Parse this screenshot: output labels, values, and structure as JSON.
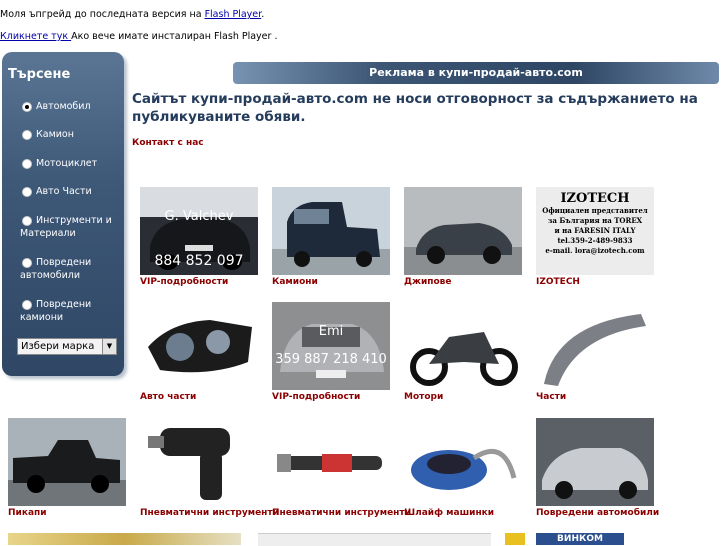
{
  "flash": {
    "line1": "Моля ъпгрейд до последната версия на ",
    "line1_link": "Flash Player",
    "line1_end": ".",
    "line2_link": "Кликнете тук ",
    "line2_rest": "Ако вече имате инсталиран Flash Player ."
  },
  "sidebar": {
    "title": "Търсене",
    "items": [
      {
        "label": "Автомобил",
        "selected": true
      },
      {
        "label": "Камион"
      },
      {
        "label": "Мотоциклет"
      },
      {
        "label": "Авто Части"
      },
      {
        "label": "Инструменти и Материали"
      },
      {
        "label": "Повредени автомобили"
      },
      {
        "label": "Повредени камиони"
      }
    ],
    "brand_select": "Избери марка"
  },
  "banner": "Реклама в купи-продай-авто.com",
  "headline": "Сайтът купи-продай-авто.com не носи отговорност за съдържанието на публикуваните обяви.",
  "contact": "Контакт с нас",
  "tiles": [
    {
      "caption": "VIP-подробности",
      "overlay_name": "G. Valchev",
      "overlay_phone": "884 852 097"
    },
    {
      "caption": "Камиони"
    },
    {
      "caption": "Джипове"
    },
    {
      "caption": "IZOTECH",
      "izo_title": "IZOTECH",
      "izo_lines": [
        "Официален представител",
        "за България на TOREX",
        "и на FARESIN ITALY",
        "tel.359-2-489-9833",
        "e-mail. lora@izotech.com"
      ]
    },
    {
      "caption": "Авто части"
    },
    {
      "caption": "VIP-подробности",
      "overlay_name": "Emi",
      "overlay_phone": "359 887 218 410"
    },
    {
      "caption": "Мотори"
    },
    {
      "caption": "Части"
    },
    {
      "caption": "Пикапи"
    },
    {
      "caption": "Пневматични инструменти"
    },
    {
      "caption": "Пневматични инструменти"
    },
    {
      "caption": "Шлайф машинки"
    },
    {
      "caption": "Повредени автомобили"
    }
  ],
  "bottom_logo": "ВИНКОМ"
}
